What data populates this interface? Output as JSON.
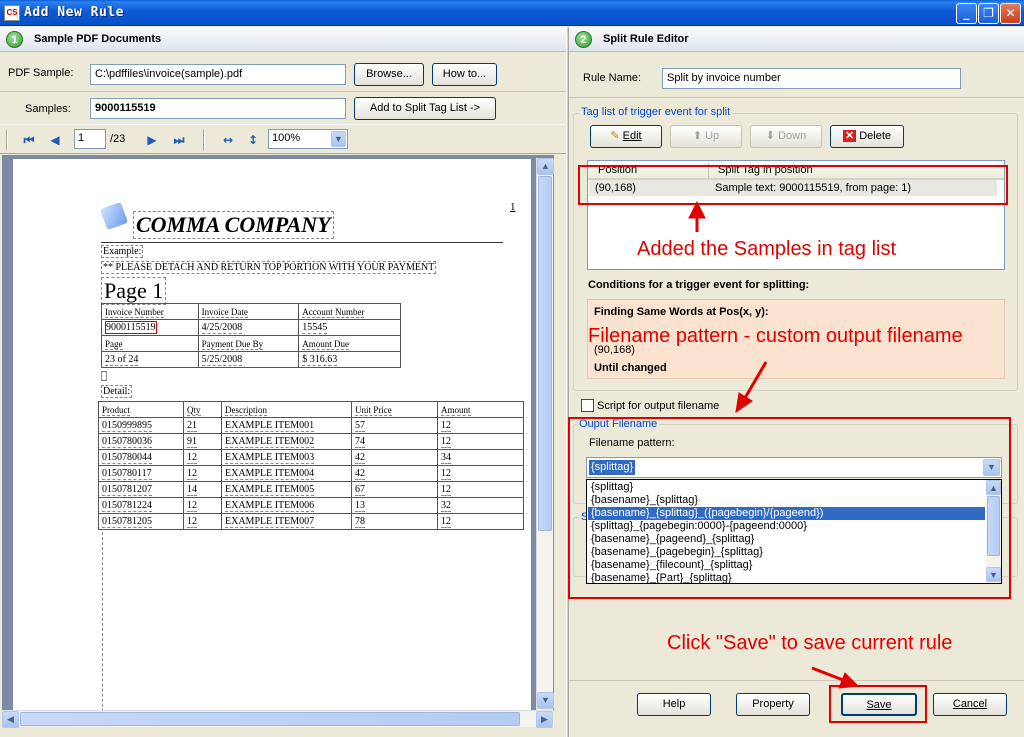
{
  "window": {
    "title": "Add New Rule",
    "icon_text": "CS",
    "minimize": "_",
    "maximize": "❐",
    "close": "✕"
  },
  "left": {
    "header_num": "1",
    "header_title": "Sample PDF Documents",
    "pdf_sample_label": "PDF Sample:",
    "pdf_sample_value": "C:\\pdffiles\\invoice(sample).pdf",
    "browse_label": "Browse...",
    "howto_label": "How to...",
    "samples_label": "Samples:",
    "samples_value": "9000115519",
    "add_split_label": "Add to Split Tag List ->",
    "page_num": "1",
    "page_total": "/23",
    "zoom": "100%"
  },
  "doc": {
    "company": "COMMA COMPANY",
    "corner": "1",
    "example": "Example:",
    "instruction": "** PLEASE DETACH AND RETURN TOP PORTION WITH YOUR PAYMENT",
    "page_title": "Page 1",
    "table1": [
      [
        "Invoice Number",
        "Invoice Date",
        "Account Number"
      ],
      [
        "9000115519",
        "4/25/2008",
        "15545"
      ],
      [
        "Page",
        "Payment Due By",
        "Amount Due"
      ],
      [
        "23 of 24",
        "5/25/2008",
        "$ 316.63"
      ]
    ],
    "detail": "Detail:",
    "table2_head": [
      "Product",
      "Qty",
      "Description",
      "Unit Price",
      "Amount"
    ],
    "table2": [
      [
        "0150999895",
        "21",
        "EXAMPLE ITEM001",
        "57",
        "12"
      ],
      [
        "0150780036",
        "91",
        "EXAMPLE ITEM002",
        "74",
        "12"
      ],
      [
        "0150780044",
        "12",
        "EXAMPLE ITEM003",
        "42",
        "34"
      ],
      [
        "0150780117",
        "12",
        "EXAMPLE ITEM004",
        "42",
        "12"
      ],
      [
        "0150781207",
        "14",
        "EXAMPLE ITEM005",
        "67",
        "12"
      ],
      [
        "0150781224",
        "12",
        "EXAMPLE ITEM006",
        "13",
        "32"
      ],
      [
        "0150781205",
        "12",
        "EXAMPLE ITEM007",
        "78",
        "12"
      ]
    ]
  },
  "right": {
    "header_num": "2",
    "header_title": "Split Rule Editor",
    "rule_name_label": "Rule Name:",
    "rule_name_value": "Split by invoice number",
    "tag_list_legend": "Tag list of trigger event for split",
    "edit_label": "Edit",
    "up_label": "Up",
    "down_label": "Down",
    "delete_label": "Delete",
    "col_position": "Position",
    "col_split_tag": "Split Tag in position",
    "row_position": "(90,168)",
    "row_tag": "Sample text: 9000115519, from page: 1)",
    "conditions_label": "Conditions for a trigger event for splitting:",
    "finding_label": "Finding Same Words at Pos(x, y):",
    "cond_pos": "(90,168)",
    "until_changed": "Until changed",
    "script_label": "Script for output filename",
    "output_legend": "Ouput Filename",
    "filename_pattern_label": "Filename pattern:",
    "pattern_value": "{splittag}",
    "hidden_legend": "S",
    "pattern_options": [
      "{splittag}",
      "{basename}_{splittag}",
      "{basename}_{splittag}_({pagebegin}/{pageend})",
      "{splittag}_{pagebegin:0000}-{pageend:0000}",
      "{basename}_{pageend}_{splittag}",
      "{basename}_{pagebegin}_{splittag}",
      "{basename}_{filecount}_{splittag}",
      "{basename}_{Part}_{splittag}"
    ],
    "help_label": "Help",
    "property_label": "Property",
    "save_label": "Save",
    "cancel_label": "Cancel"
  },
  "annotations": {
    "samples_added": "Added the Samples in tag list",
    "filename_pattern": "Filename pattern - custom output filename",
    "click_save": "Click \"Save\" to save current rule"
  },
  "colors": {
    "annotation_red": "#e00000",
    "title_blue": "#0c5ad6",
    "condition_bg": "#fce3d0",
    "highlight": "#316ac5"
  }
}
